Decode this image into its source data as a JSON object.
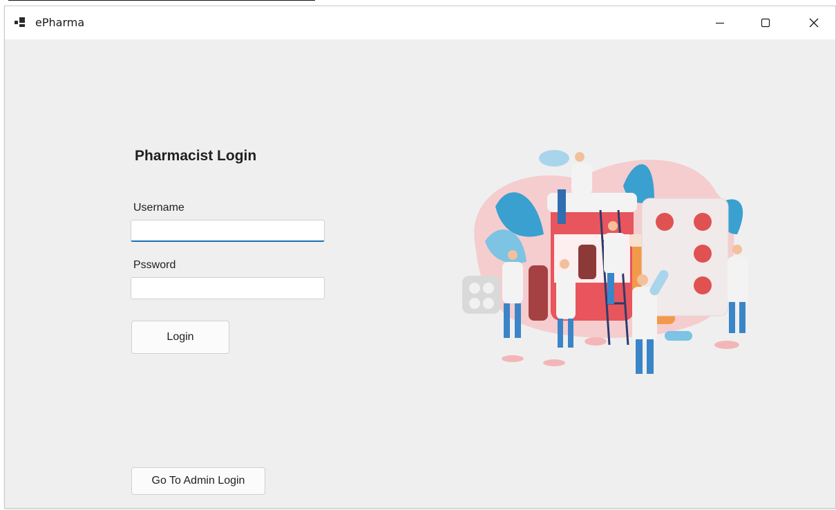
{
  "window": {
    "title": "ePharma",
    "controls": [
      "minimize",
      "maximize",
      "close"
    ]
  },
  "login": {
    "heading": "Pharmacist Login",
    "username_label": "Username",
    "username_value": "",
    "password_label": "Pssword",
    "password_value": "",
    "login_button": "Login",
    "admin_button": "Go To Admin Login"
  },
  "colors": {
    "accent": "#1a6fb3",
    "background": "#efefef",
    "illustration_red": "#e8555c",
    "illustration_blue": "#3aa0d0"
  },
  "icons": {
    "app": "app-icon",
    "minimize": "minimize-icon",
    "maximize": "maximize-icon",
    "close": "close-icon"
  }
}
